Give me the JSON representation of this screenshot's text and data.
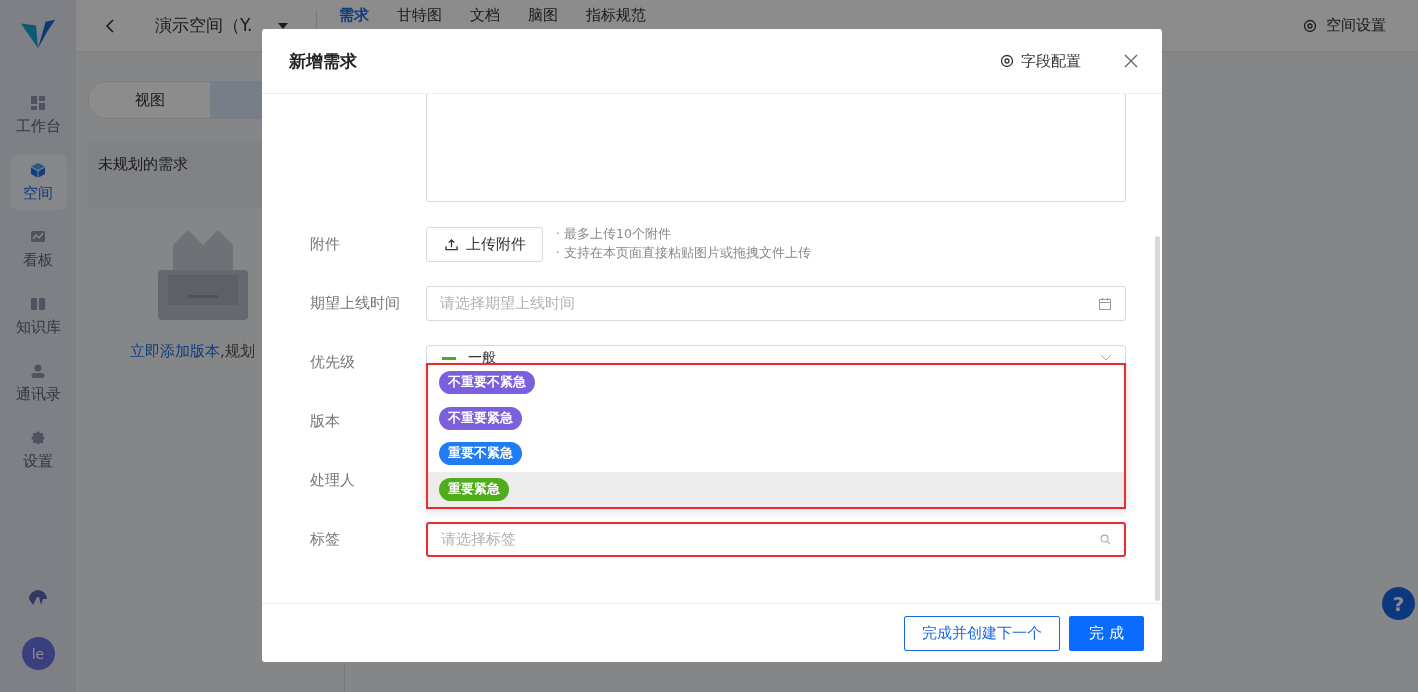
{
  "sidebar": {
    "items": [
      {
        "label": "工作台",
        "kind": "dashboard",
        "selected": false
      },
      {
        "label": "空间",
        "kind": "cube",
        "selected": true
      },
      {
        "label": "看板",
        "kind": "chart",
        "selected": false
      },
      {
        "label": "知识库",
        "kind": "book",
        "selected": false
      },
      {
        "label": "通讯录",
        "kind": "person",
        "selected": false
      },
      {
        "label": "设置",
        "kind": "gear",
        "selected": false
      }
    ],
    "avatar": "le"
  },
  "header": {
    "space_name": "演示空间（Y.",
    "tabs": [
      {
        "label": "需求",
        "selected": true
      },
      {
        "label": "甘特图",
        "selected": false
      },
      {
        "label": "文档",
        "selected": false
      },
      {
        "label": "脑图",
        "selected": false
      },
      {
        "label": "指标规范",
        "selected": false
      }
    ],
    "settings": "空间设置",
    "help": "?"
  },
  "left_panel": {
    "segments": [
      {
        "label": "视图",
        "selected": false
      },
      {
        "selected": true
      }
    ],
    "card": "未规划的需求",
    "empty_link": "立即添加版本",
    "empty_text": ",规划"
  },
  "modal": {
    "title": "新增需求",
    "field_config": "字段配置",
    "fields": [
      {
        "kind": "textarea"
      },
      {
        "kind": "upload",
        "label": "附件",
        "button": "上传附件",
        "hints": [
          "· 最多上传10个附件",
          "· 支持在本页面直接粘贴图片或拖拽文件上传"
        ]
      },
      {
        "kind": "date",
        "label": "期望上线时间",
        "placeholder": "请选择期望上线时间"
      },
      {
        "kind": "select",
        "label": "优先级",
        "value": "一般"
      },
      {
        "kind": "covered",
        "label": "版本"
      },
      {
        "kind": "covered",
        "label": "处理人"
      },
      {
        "kind": "tag-input",
        "label": "标签",
        "placeholder": "请选择标签",
        "highlighted": true
      }
    ],
    "priority_dropdown": {
      "highlighted": true,
      "options": [
        {
          "label": "不重要不紧急",
          "color": "#7b5fdc",
          "hovered": false
        },
        {
          "label": "不重要紧急",
          "color": "#7b5fdc",
          "hovered": false
        },
        {
          "label": "重要不紧急",
          "color": "#1f7cf2",
          "hovered": false
        },
        {
          "label": "重要紧急",
          "color": "#4fad1b",
          "hovered": true
        }
      ]
    },
    "buttons": [
      {
        "label": "完成并创建下一个",
        "kind": "secondary"
      },
      {
        "label": "完 成",
        "kind": "primary"
      }
    ]
  }
}
